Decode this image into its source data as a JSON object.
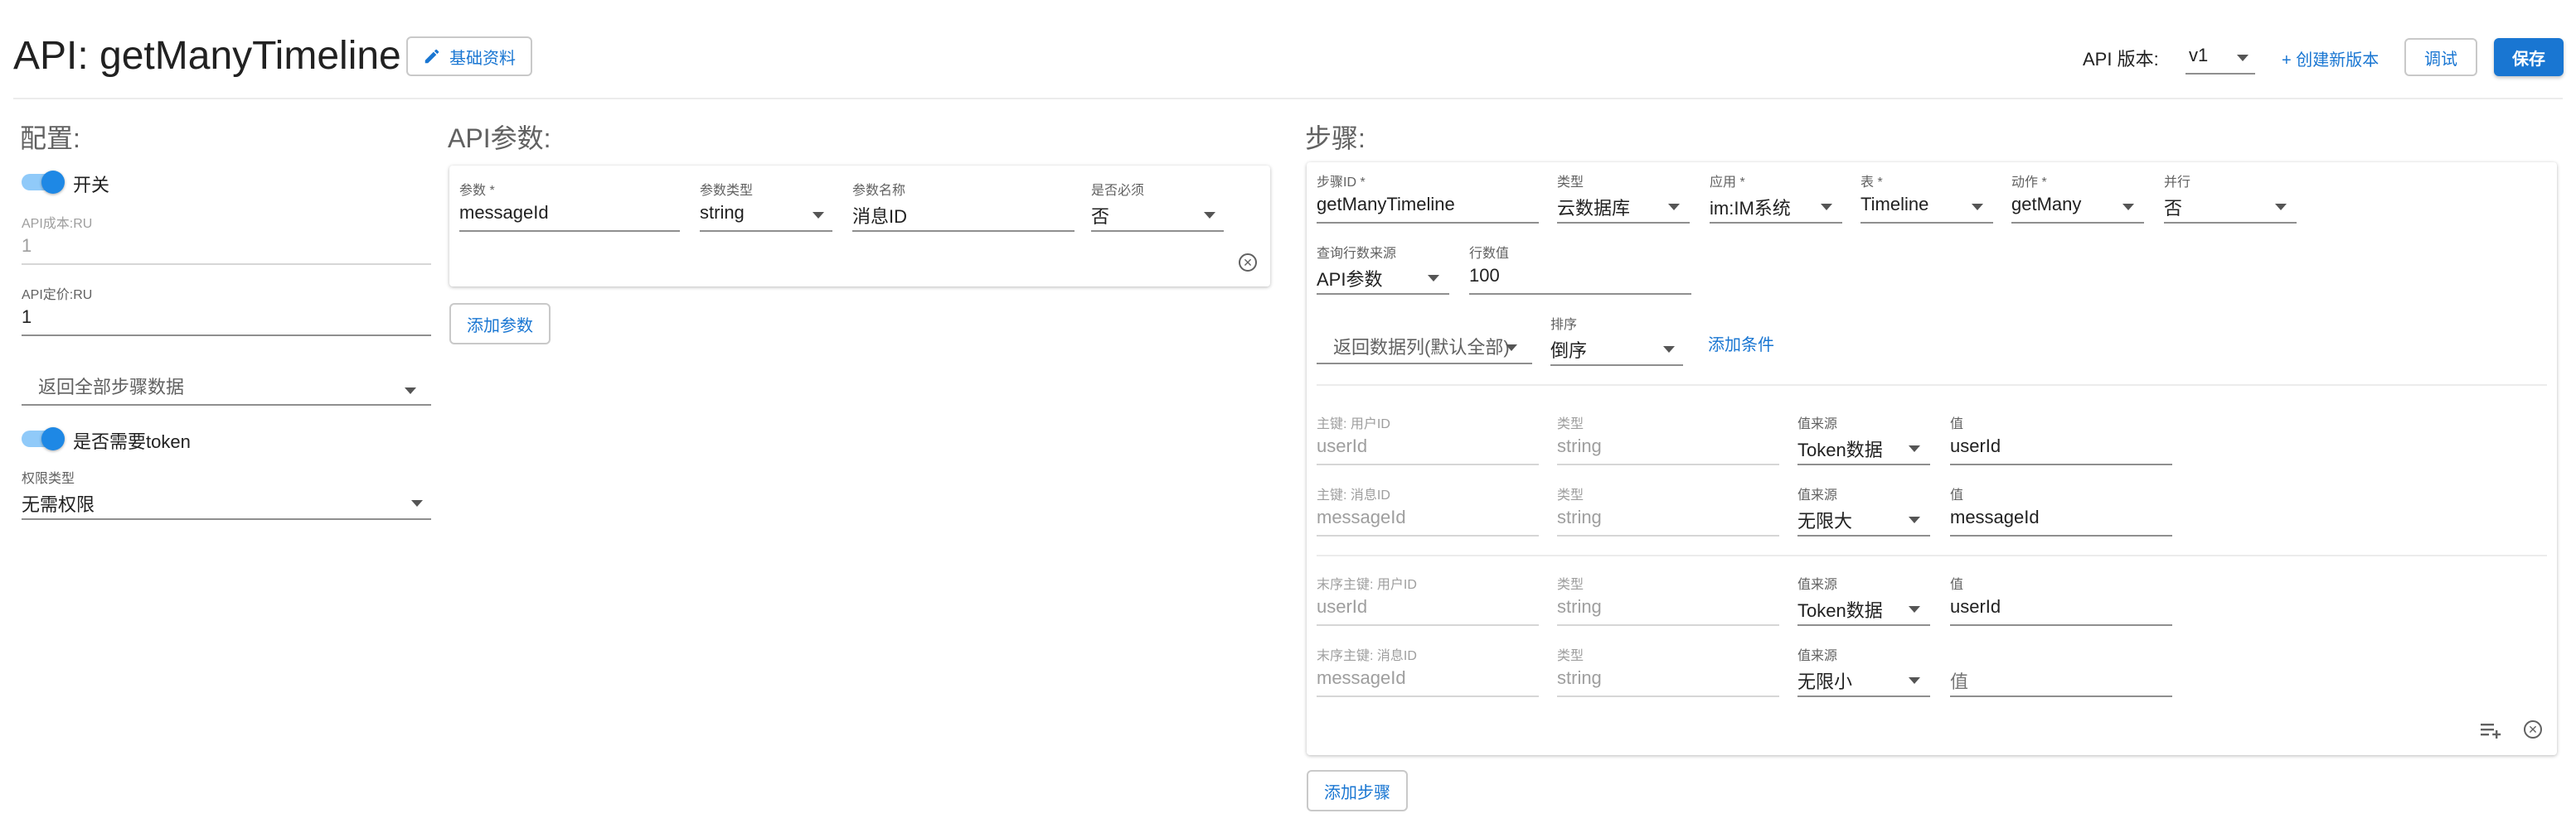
{
  "header": {
    "title": "API: getManyTimeline",
    "basic_info_label": "基础资料",
    "api_version_label": "API 版本:",
    "api_version_value": "v1",
    "create_version_label": "+ 创建新版本",
    "debug_label": "调试",
    "save_label": "保存"
  },
  "config": {
    "title": "配置:",
    "switch_label": "开关",
    "cost_label": "API成本:RU",
    "cost_value": "1",
    "price_label": "API定价:RU",
    "price_value": "1",
    "return_select": "返回全部步骤数据",
    "token_label": "是否需要token",
    "permission_label": "权限类型",
    "permission_value": "无需权限"
  },
  "params": {
    "title": "API参数:",
    "headers": {
      "param": "参数 *",
      "type": "参数类型",
      "name": "参数名称",
      "required": "是否必须"
    },
    "row": {
      "param": "messageId",
      "type": "string",
      "name": "消息ID",
      "required": "否"
    },
    "add_label": "添加参数"
  },
  "steps": {
    "title": "步骤:",
    "row1_labels": {
      "id": "步骤ID *",
      "type": "类型",
      "app": "应用 *",
      "table": "表 *",
      "action": "动作 *",
      "parallel": "并行"
    },
    "row1_values": {
      "id": "getManyTimeline",
      "type": "云数据库",
      "app": "im:IM系统",
      "table": "Timeline",
      "action": "getMany",
      "parallel": "否"
    },
    "row2_labels": {
      "source": "查询行数来源",
      "count": "行数值"
    },
    "row2_values": {
      "source": "API参数",
      "count": "100"
    },
    "columns_select": "返回数据列(默认全部)",
    "sort_label": "排序",
    "sort_value": "倒序",
    "add_condition": "添加条件",
    "keys": [
      {
        "key_label": "主键: 用户ID",
        "key_value": "userId",
        "type_label": "类型",
        "type_value": "string",
        "src_label": "值来源",
        "src_value": "Token数据",
        "val_label": "值",
        "val_value": "userId"
      },
      {
        "key_label": "主键: 消息ID",
        "key_value": "messageId",
        "type_label": "类型",
        "type_value": "string",
        "src_label": "值来源",
        "src_value": "无限大",
        "val_label": "值",
        "val_value": "messageId"
      },
      {
        "key_label": "末序主键: 用户ID",
        "key_value": "userId",
        "type_label": "类型",
        "type_value": "string",
        "src_label": "值来源",
        "src_value": "Token数据",
        "val_label": "值",
        "val_value": "userId"
      },
      {
        "key_label": "末序主键: 消息ID",
        "key_value": "messageId",
        "type_label": "类型",
        "type_value": "string",
        "src_label": "值来源",
        "src_value": "无限小",
        "val_label": "",
        "val_value": "",
        "val_placeholder": "值"
      }
    ],
    "add_step_label": "添加步骤"
  },
  "colors": {
    "accent": "#1976d2",
    "toggle_track": "#90caf9",
    "toggle_knob": "#1e88e5"
  },
  "icons": {
    "edit": "pencil-icon",
    "caret": "caret-down-icon",
    "close": "close-circle-icon",
    "add_row": "playlist-add-icon"
  }
}
